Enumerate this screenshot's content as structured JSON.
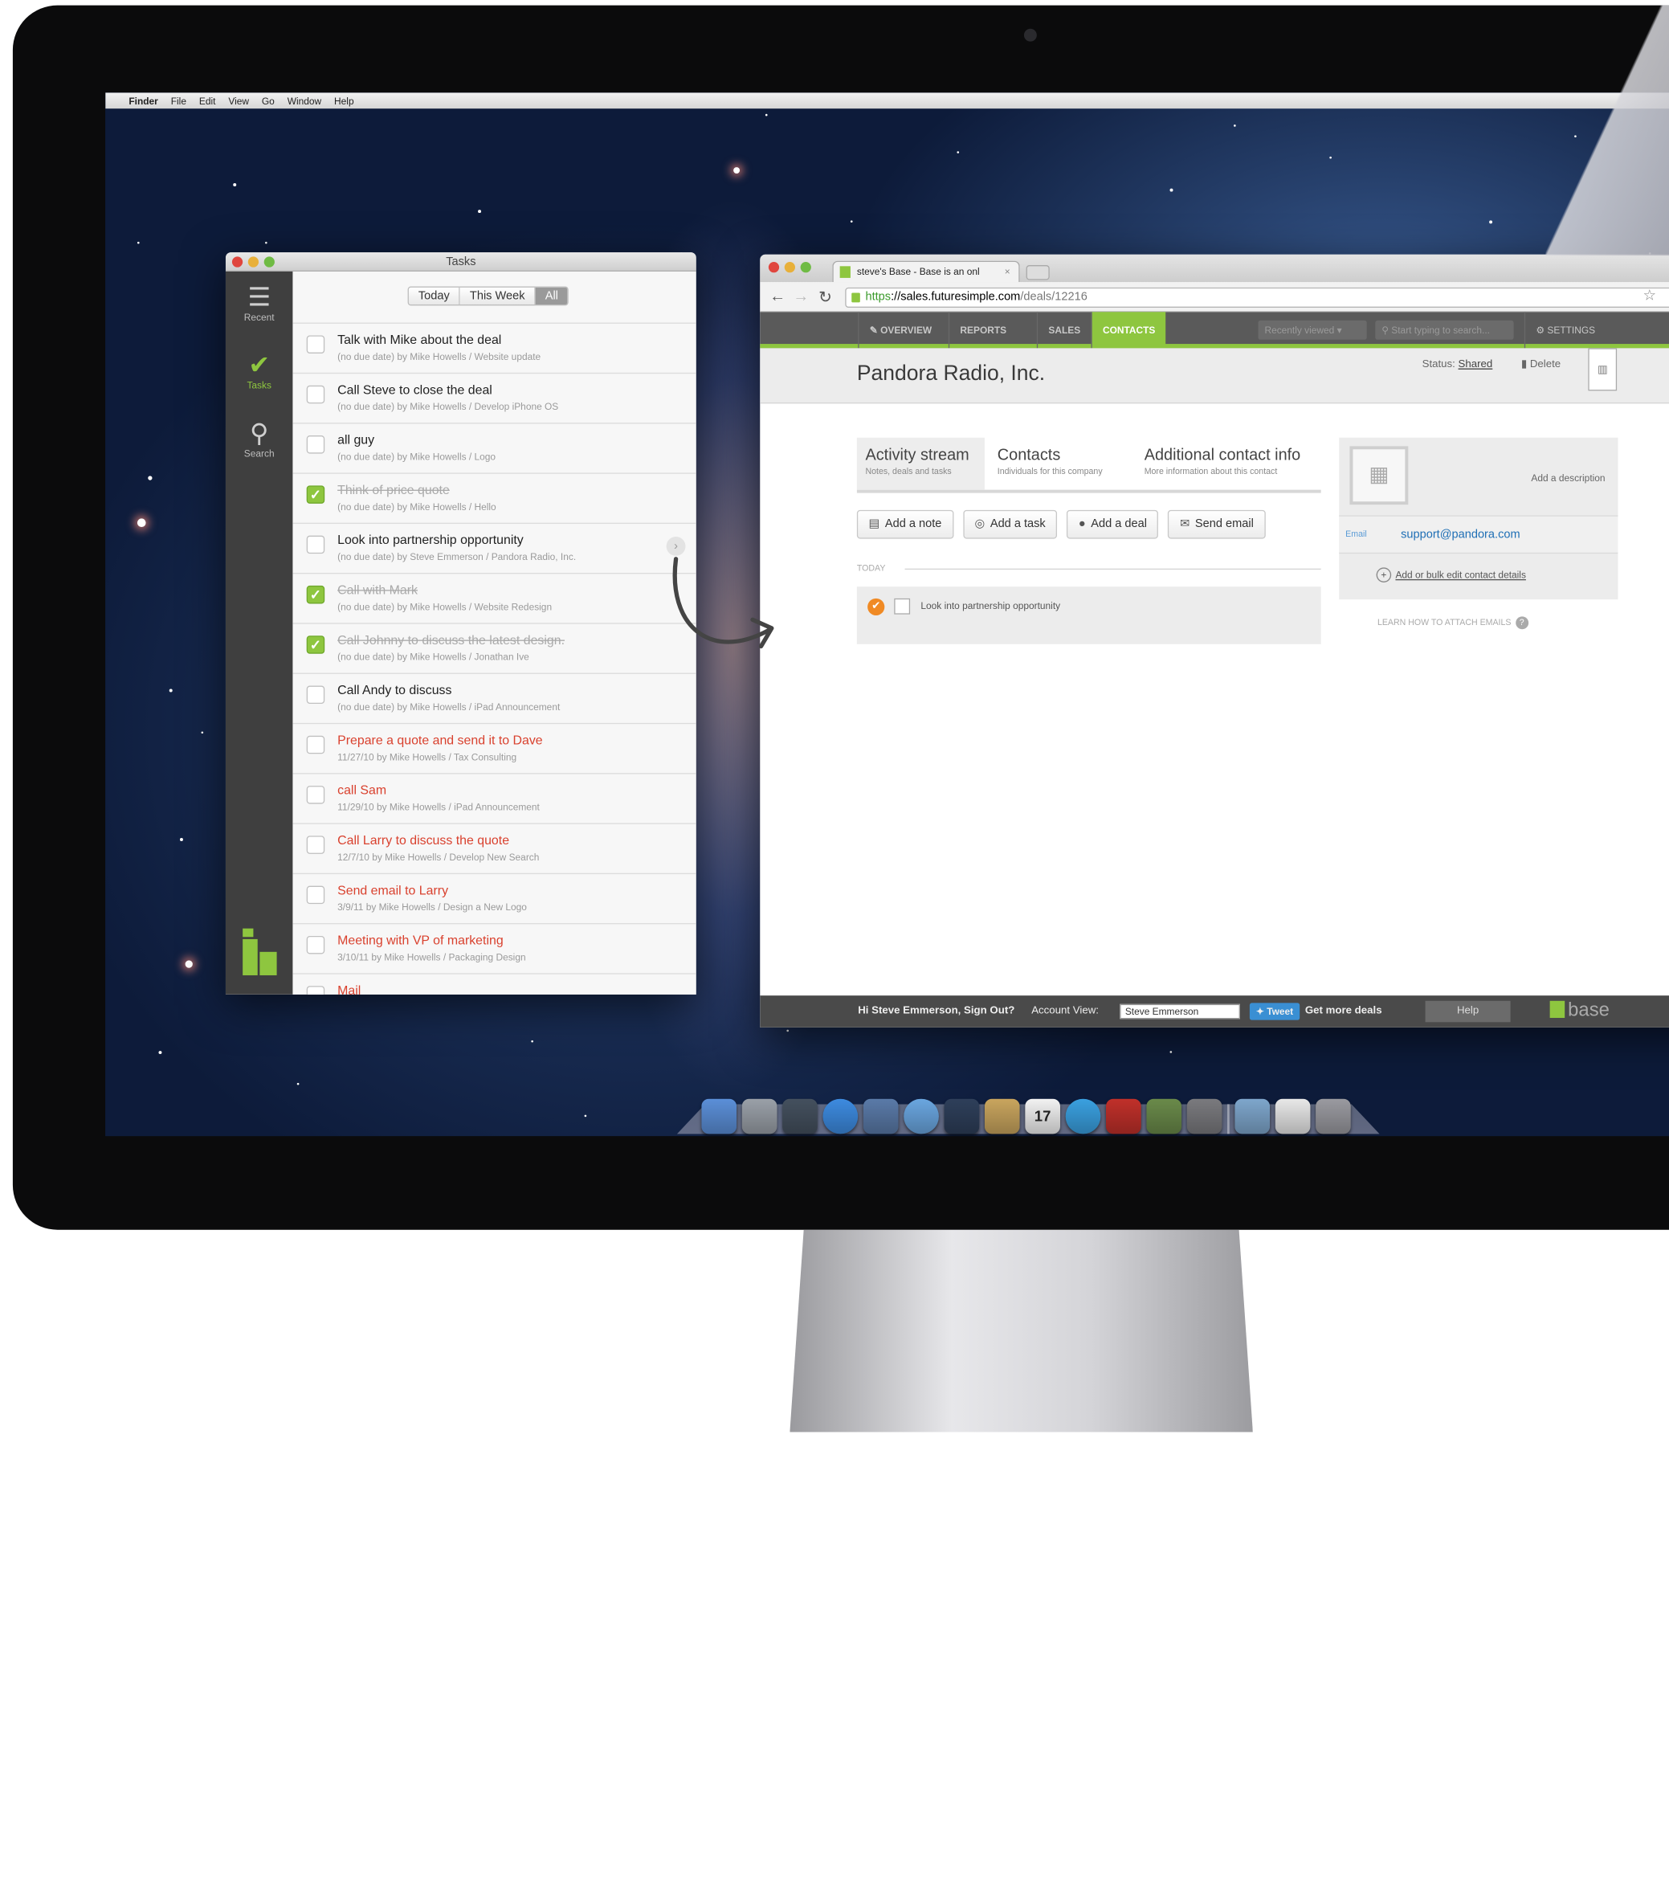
{
  "menubar": {
    "items": [
      "Finder",
      "File",
      "Edit",
      "View",
      "Go",
      "Window",
      "Help"
    ]
  },
  "tasks_window": {
    "title": "Tasks",
    "sidebar": [
      {
        "label": "Recent",
        "icon": "list-icon"
      },
      {
        "label": "Tasks",
        "icon": "check-icon"
      },
      {
        "label": "Search",
        "icon": "search-icon"
      }
    ],
    "filters": [
      "Today",
      "This Week",
      "All"
    ],
    "selected_filter": "All",
    "tasks": [
      {
        "title": "Talk with Mike about the deal",
        "meta": "(no due date) by Mike Howells / Website update",
        "done": false,
        "overdue": false
      },
      {
        "title": "Call Steve to close the deal",
        "meta": "(no due date) by Mike Howells / Develop iPhone OS",
        "done": false,
        "overdue": false
      },
      {
        "title": "all guy",
        "meta": "(no due date) by Mike Howells / Logo",
        "done": false,
        "overdue": false
      },
      {
        "title": "Think of price quote",
        "meta": "(no due date) by Mike Howells / Hello",
        "done": true,
        "overdue": false
      },
      {
        "title": "Look into partnership opportunity",
        "meta": "(no due date) by Steve Emmerson / Pandora Radio, Inc.",
        "done": false,
        "overdue": false
      },
      {
        "title": "Call with Mark",
        "meta": "(no due date) by Mike Howells / Website Redesign",
        "done": true,
        "overdue": false
      },
      {
        "title": "Call Johnny to discuss the latest design.",
        "meta": "(no due date) by Mike Howells / Jonathan Ive",
        "done": true,
        "overdue": false
      },
      {
        "title": "Call Andy to discuss",
        "meta": "(no due date) by Mike Howells / iPad Announcement",
        "done": false,
        "overdue": false
      },
      {
        "title": "Prepare a quote and send it to Dave",
        "meta": "11/27/10 by Mike Howells / Tax Consulting",
        "done": false,
        "overdue": true
      },
      {
        "title": "call Sam",
        "meta": "11/29/10 by Mike Howells / iPad Announcement",
        "done": false,
        "overdue": true
      },
      {
        "title": "Call Larry to discuss the quote",
        "meta": "12/7/10 by Mike Howells / Develop New Search",
        "done": false,
        "overdue": true
      },
      {
        "title": "Send email to Larry",
        "meta": "3/9/11 by Mike Howells / Design a New Logo",
        "done": false,
        "overdue": true
      },
      {
        "title": "Meeting with VP of marketing",
        "meta": "3/10/11 by Mike Howells / Packaging Design",
        "done": false,
        "overdue": true
      },
      {
        "title": "Mail",
        "meta": "",
        "done": false,
        "overdue": true
      }
    ]
  },
  "browser": {
    "tab_title": "steve's Base - Base is an onl",
    "url_scheme": "https",
    "url_host": "://sales.futuresimple.com",
    "url_path": "/deals/12216",
    "nav": [
      "OVERVIEW",
      "REPORTS",
      "SALES",
      "CONTACTS"
    ],
    "active_nav": "CONTACTS",
    "recently_viewed": "Recently viewed",
    "search_placeholder": "Start typing to search...",
    "settings": "SETTINGS",
    "page_title": "Pandora Radio, Inc.",
    "status_label": "Status:",
    "status_value": "Shared",
    "delete_label": "Delete",
    "tabs": [
      {
        "label": "Activity stream",
        "sub": "Notes, deals and tasks"
      },
      {
        "label": "Contacts",
        "sub": "Individuals for this company"
      },
      {
        "label": "Additional contact info",
        "sub": "More information about this contact"
      }
    ],
    "actions": [
      {
        "label": "Add a note",
        "icon": "note-icon"
      },
      {
        "label": "Add a task",
        "icon": "task-icon"
      },
      {
        "label": "Add a deal",
        "icon": "dollar-icon"
      },
      {
        "label": "Send email",
        "icon": "mail-icon"
      }
    ],
    "today_label": "TODAY",
    "activity_item": "Look into partnership opportunity",
    "contact": {
      "add_description": "Add a description",
      "email_label": "Email",
      "email": "support@pandora.com",
      "edit_link": "Add or bulk edit contact details",
      "learn_link": "LEARN HOW TO ATTACH EMAILS"
    },
    "footer": {
      "greeting": "Hi Steve Emmerson, Sign Out?",
      "account_view": "Account View:",
      "account_value": "Steve Emmerson",
      "tweet": "Tweet",
      "more_deals": "Get more deals",
      "help": "Help",
      "brand": "base"
    }
  },
  "colors": {
    "accent": "#8ec63f",
    "overdue": "#d9412e",
    "activity_dot": "#f08a24"
  },
  "dock": {
    "icons": [
      "finder-icon",
      "launchpad-icon",
      "mission-control-icon",
      "app-store-icon",
      "preview-icon",
      "safari-icon",
      "facetime-icon",
      "contacts-icon",
      "calendar-icon",
      "itunes-icon",
      "photo-booth-icon",
      "iphoto-icon",
      "system-preferences-icon",
      "folder-icon",
      "documents-icon",
      "trash-icon"
    ],
    "calendar_day": "17"
  }
}
